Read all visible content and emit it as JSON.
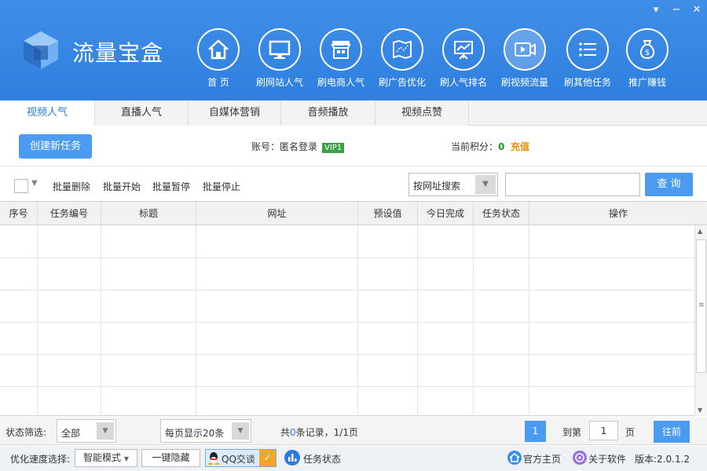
{
  "app": {
    "title": "流量宝盒"
  },
  "nav": [
    {
      "label": "首 页",
      "icon": "home-icon"
    },
    {
      "label": "刷网站人气",
      "icon": "monitor-icon"
    },
    {
      "label": "刷电商人气",
      "icon": "store-icon"
    },
    {
      "label": "刷广告优化",
      "icon": "map-icon"
    },
    {
      "label": "刷人气排名",
      "icon": "chart-board-icon"
    },
    {
      "label": "刷视频流量",
      "icon": "video-icon",
      "active": true
    },
    {
      "label": "刷其他任务",
      "icon": "list-icon"
    },
    {
      "label": "推广赚钱",
      "icon": "money-bag-icon"
    }
  ],
  "tabs": [
    "视频人气",
    "直播人气",
    "自媒体营销",
    "音频播放",
    "视频点赞"
  ],
  "actions": {
    "create_task": "创建新任务"
  },
  "account": {
    "label": "账号：",
    "name": "匿名登录",
    "vip": "VIP1"
  },
  "points": {
    "label": "当前积分：",
    "value": "0",
    "recharge": "充值"
  },
  "toolbar": {
    "batch_delete": "批量删除",
    "batch_start": "批量开始",
    "batch_pause": "批量暂停",
    "batch_stop": "批量停止",
    "search_type": "按网址搜索",
    "search_value": "",
    "query": "查 询"
  },
  "table": {
    "columns": [
      "序号",
      "任务编号",
      "标题",
      "网址",
      "预设值",
      "今日完成",
      "任务状态",
      "操作"
    ],
    "rows": []
  },
  "footer": {
    "status_filter_label": "状态筛选:",
    "status_filter_value": "全部",
    "page_size": "每页显示20条",
    "records_prefix": "共",
    "records_count": "0",
    "records_suffix": "条记录，1/1页",
    "current_page": "1",
    "goto_label": "到第",
    "goto_value": "1",
    "page_unit": "页",
    "goto_button": "往前"
  },
  "bottom": {
    "speed_label": "优化速度选择:",
    "speed_mode": "智能模式",
    "hide_button": "一键隐藏",
    "qq_button": "QQ交谈",
    "task_status": "任务状态",
    "homepage": "官方主页",
    "about": "关于软件",
    "version": "版本:2.0.1.2"
  },
  "colors": {
    "header": "#3589e6",
    "accent": "#4b9bf0",
    "vip": "#3aa14a",
    "recharge": "#f08c00"
  }
}
